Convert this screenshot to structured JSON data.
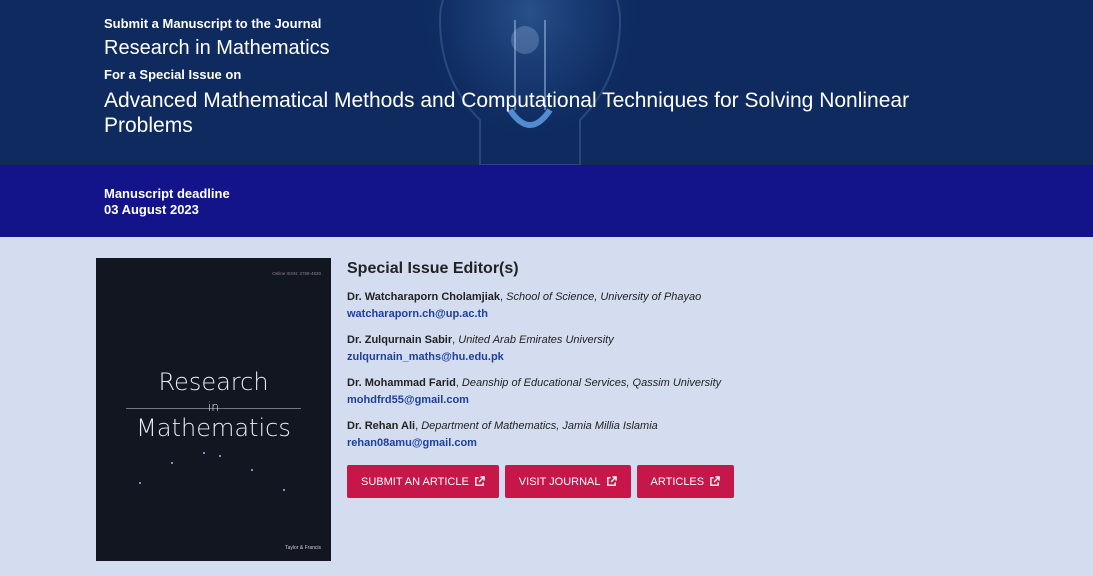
{
  "hero": {
    "kicker": "Submit a Manuscript to the Journal",
    "journal": "Research in Mathematics",
    "kicker2": "For a Special Issue on",
    "issue_title": "Advanced Mathematical Methods and Computational Techniques for Solving Nonlinear Problems"
  },
  "deadline": {
    "label": "Manuscript deadline",
    "date": "03 August 2023"
  },
  "cover": {
    "issn": "Online ISSN: 2768-4830",
    "title_line1": "Research",
    "title_line2": "in",
    "title_line3": "Mathematics",
    "publisher": "Taylor & Francis"
  },
  "editors": {
    "heading": "Special Issue Editor(s)",
    "list": [
      {
        "name": "Dr. Watcharaporn Cholamjiak",
        "affiliation": "School of Science, University of Phayao",
        "email": "watcharaporn.ch@up.ac.th"
      },
      {
        "name": "Dr. Zulqurnain Sabir",
        "affiliation": "United Arab Emirates University",
        "email": "zulqurnain_maths@hu.edu.pk"
      },
      {
        "name": "Dr. Mohammad Farid",
        "affiliation": "Deanship of Educational Services, Qassim University",
        "email": "mohdfrd55@gmail.com"
      },
      {
        "name": "Dr. Rehan Ali",
        "affiliation": "Department of Mathematics, Jamia Millia Islamia",
        "email": "rehan08amu@gmail.com"
      }
    ]
  },
  "buttons": {
    "submit": "SUBMIT AN ARTICLE",
    "visit": "VISIT JOURNAL",
    "articles": "ARTICLES"
  },
  "colors": {
    "hero_bg": "#0e2a5e",
    "deadline_bg": "#14148a",
    "page_bg": "#d3ddef",
    "button_bg": "#c6164a",
    "link": "#1e3fa0"
  },
  "icons": [
    "lightbulb-image",
    "external-link-icon"
  ]
}
